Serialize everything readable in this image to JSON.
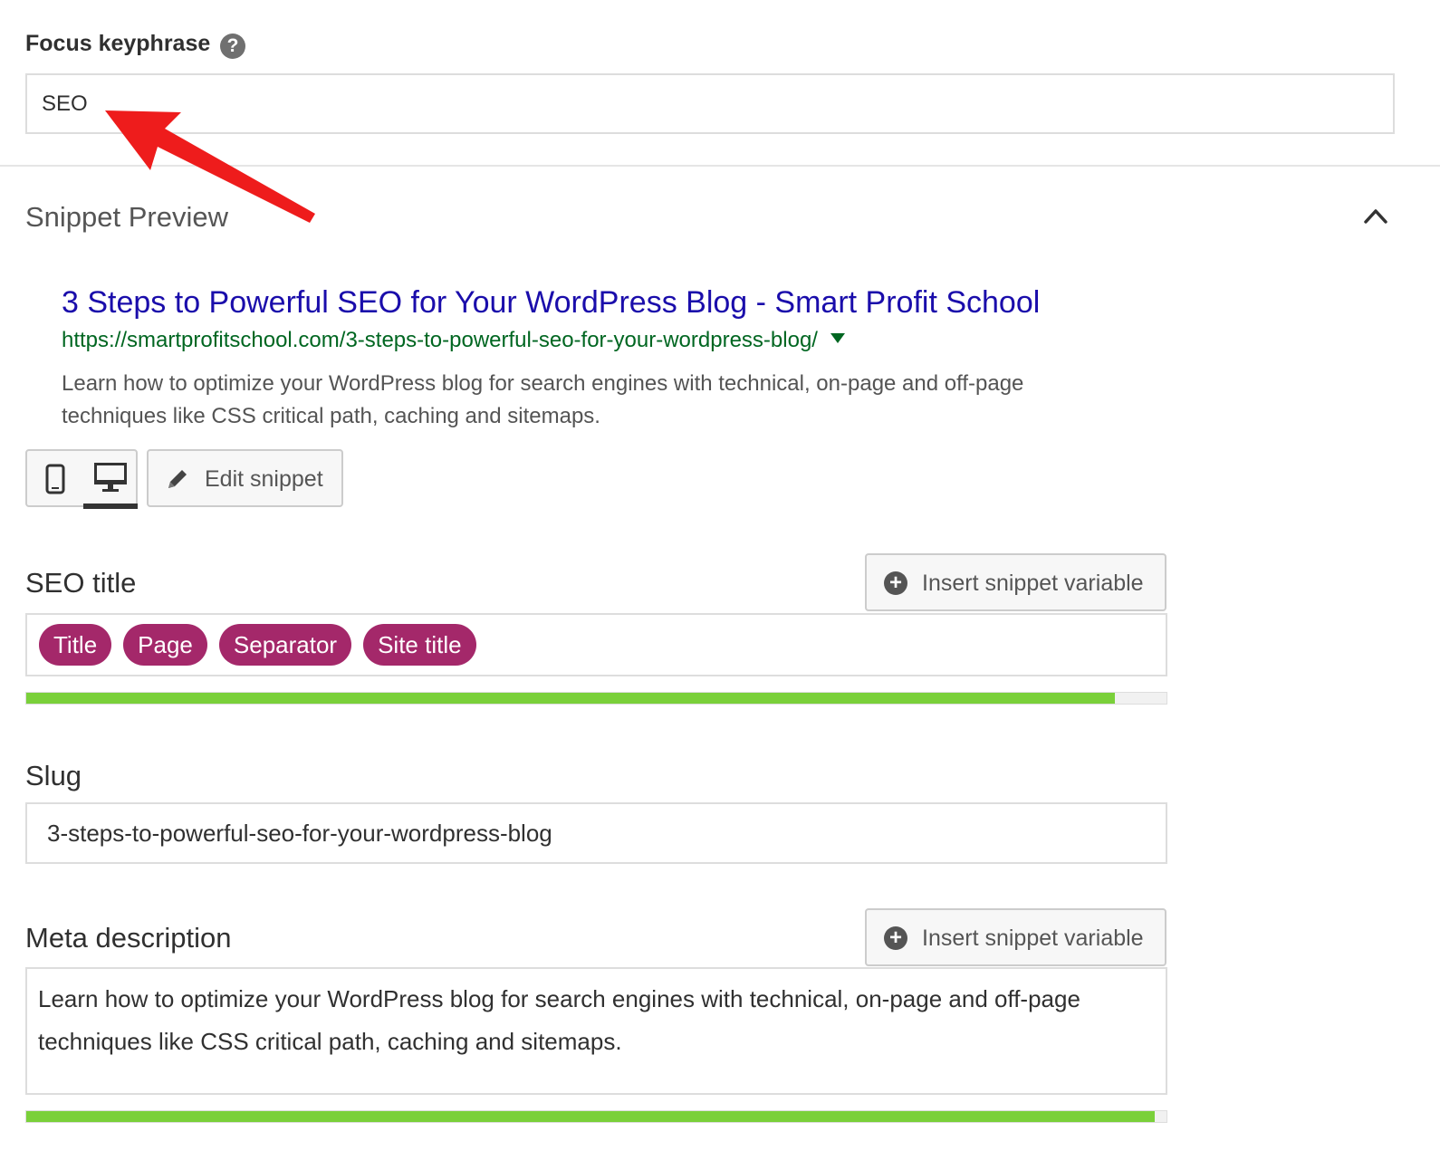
{
  "focus_keyphrase": {
    "label": "Focus keyphrase",
    "help_icon": "question-circle-icon",
    "value": "SEO"
  },
  "snippet_preview": {
    "heading": "Snippet Preview",
    "collapse_icon": "chevron-up-icon",
    "google": {
      "title": "3 Steps to Powerful SEO for Your WordPress Blog - Smart Profit School",
      "url": "https://smartprofitschool.com/3-steps-to-powerful-seo-for-your-wordpress-blog/",
      "description": "Learn how to optimize your WordPress blog for search engines with technical, on-page and off-page techniques like CSS critical path, caching and sitemaps."
    },
    "modes": {
      "mobile_icon": "mobile-phone-icon",
      "desktop_icon": "desktop-monitor-icon",
      "active": "desktop"
    },
    "edit_snippet_label": "Edit snippet"
  },
  "seo_title": {
    "label": "SEO title",
    "insert_label": "Insert snippet variable",
    "variables": [
      "Title",
      "Page",
      "Separator",
      "Site title"
    ],
    "progress": 0.955
  },
  "slug": {
    "label": "Slug",
    "value": "3-steps-to-powerful-seo-for-your-wordpress-blog"
  },
  "meta_description": {
    "label": "Meta description",
    "insert_label": "Insert snippet variable",
    "value": "Learn how to optimize your WordPress blog for search engines with technical, on-page and off-page techniques like CSS critical path, caching and sitemaps.",
    "progress": 0.99
  },
  "colors": {
    "pill": "#a4286a",
    "progress_good": "#7ad03a",
    "google_title": "#1a0dab",
    "google_url": "#006621",
    "annotation_arrow": "#ee1c1c"
  }
}
